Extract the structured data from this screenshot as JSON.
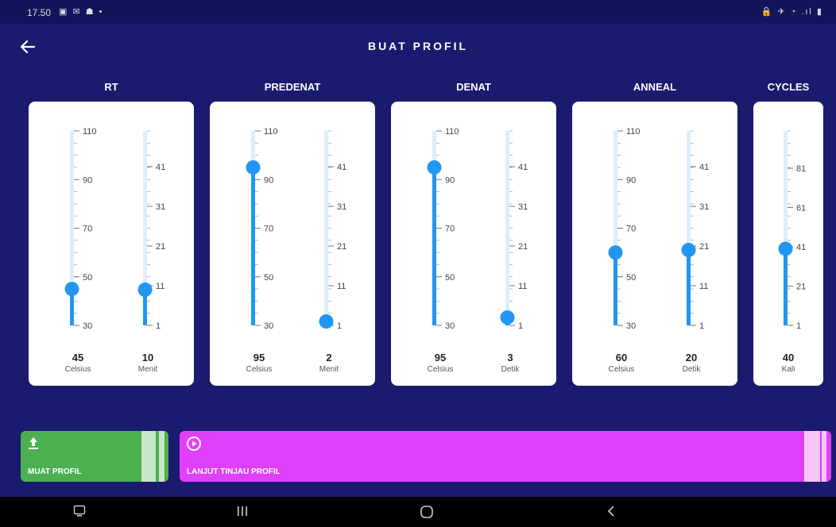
{
  "status_bar": {
    "time": "17.50",
    "left_icons": "▣ ✉ ☗ •",
    "right_icons": "🔒 ✈ ◔ .ıl ▮"
  },
  "header": {
    "title": "BUAT PROFIL"
  },
  "columns": [
    {
      "label": "RT",
      "sliders": [
        {
          "value": "45",
          "unit": "Celsius",
          "ticks": [
            "110",
            "90",
            "70",
            "50",
            "30"
          ],
          "min": 30,
          "max": 110,
          "current": 45
        },
        {
          "value": "10",
          "unit": "Menit",
          "ticks": [
            "41",
            "31",
            "21",
            "11",
            "1"
          ],
          "min": 1,
          "max": 50,
          "current": 10
        }
      ]
    },
    {
      "label": "PREDENAT",
      "sliders": [
        {
          "value": "95",
          "unit": "Celsius",
          "ticks": [
            "110",
            "90",
            "70",
            "50",
            "30"
          ],
          "min": 30,
          "max": 110,
          "current": 95
        },
        {
          "value": "2",
          "unit": "Menit",
          "ticks": [
            "41",
            "31",
            "21",
            "11",
            "1"
          ],
          "min": 1,
          "max": 50,
          "current": 2
        }
      ]
    },
    {
      "label": "DENAT",
      "sliders": [
        {
          "value": "95",
          "unit": "Celsius",
          "ticks": [
            "110",
            "90",
            "70",
            "50",
            "30"
          ],
          "min": 30,
          "max": 110,
          "current": 95
        },
        {
          "value": "3",
          "unit": "Detik",
          "ticks": [
            "41",
            "31",
            "21",
            "11",
            "1"
          ],
          "min": 1,
          "max": 50,
          "current": 3
        }
      ]
    },
    {
      "label": "ANNEAL",
      "sliders": [
        {
          "value": "60",
          "unit": "Celsius",
          "ticks": [
            "110",
            "90",
            "70",
            "50",
            "30"
          ],
          "min": 30,
          "max": 110,
          "current": 60
        },
        {
          "value": "20",
          "unit": "Detik",
          "ticks": [
            "41",
            "31",
            "21",
            "11",
            "1"
          ],
          "min": 1,
          "max": 50,
          "current": 20
        }
      ]
    },
    {
      "label": "CYCLES",
      "sliders": [
        {
          "value": "40",
          "unit": "Kali",
          "ticks": [
            "81",
            "61",
            "41",
            "21",
            "1"
          ],
          "min": 1,
          "max": 100,
          "current": 40
        }
      ]
    }
  ],
  "buttons": {
    "load_label": "MUAT PROFIL",
    "continue_label": "LANJUT TINJAU PROFIL"
  },
  "colors": {
    "background": "#1a1a6e",
    "accent": "#2196f3",
    "green": "#4caf50",
    "magenta": "#e040fb"
  }
}
